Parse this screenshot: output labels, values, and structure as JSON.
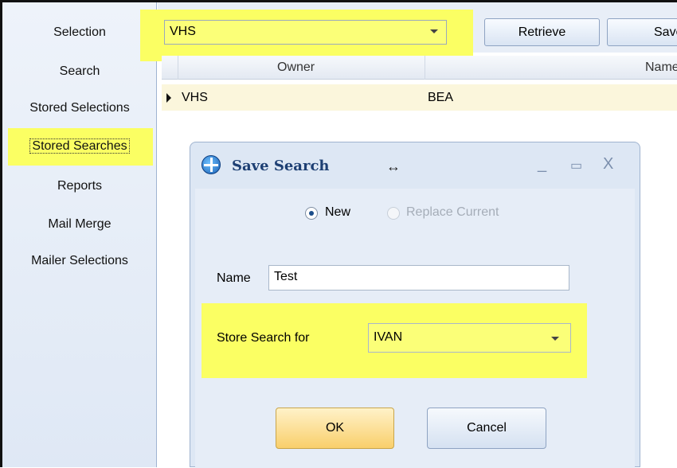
{
  "sidebar": {
    "items": [
      {
        "label": "Selection"
      },
      {
        "label": "Search"
      },
      {
        "label": "Stored Selections"
      },
      {
        "label": "Stored Searches"
      },
      {
        "label": "Reports"
      },
      {
        "label": "Mail Merge"
      },
      {
        "label": "Mailer Selections"
      }
    ],
    "selected": "Stored Searches"
  },
  "toolbar": {
    "combo_value": "VHS",
    "retrieve_label": "Retrieve",
    "save_label": "Save"
  },
  "grid": {
    "columns": [
      "Owner",
      "Name"
    ],
    "rows": [
      {
        "col1": "VHS",
        "col2": "BEA"
      }
    ]
  },
  "dialog": {
    "title": "Save Search",
    "move_glyph": "↔",
    "minimize": "_",
    "maximize": "▭",
    "close": "X",
    "radio_new": "New",
    "radio_replace": "Replace Current",
    "name_label": "Name",
    "name_value": "Test",
    "store_label": "Store Search for",
    "store_value": "IVAN",
    "ok_label": "OK",
    "cancel_label": "Cancel"
  },
  "colors": {
    "highlight": "#fbff63",
    "accent_title": "#1d3f73"
  }
}
